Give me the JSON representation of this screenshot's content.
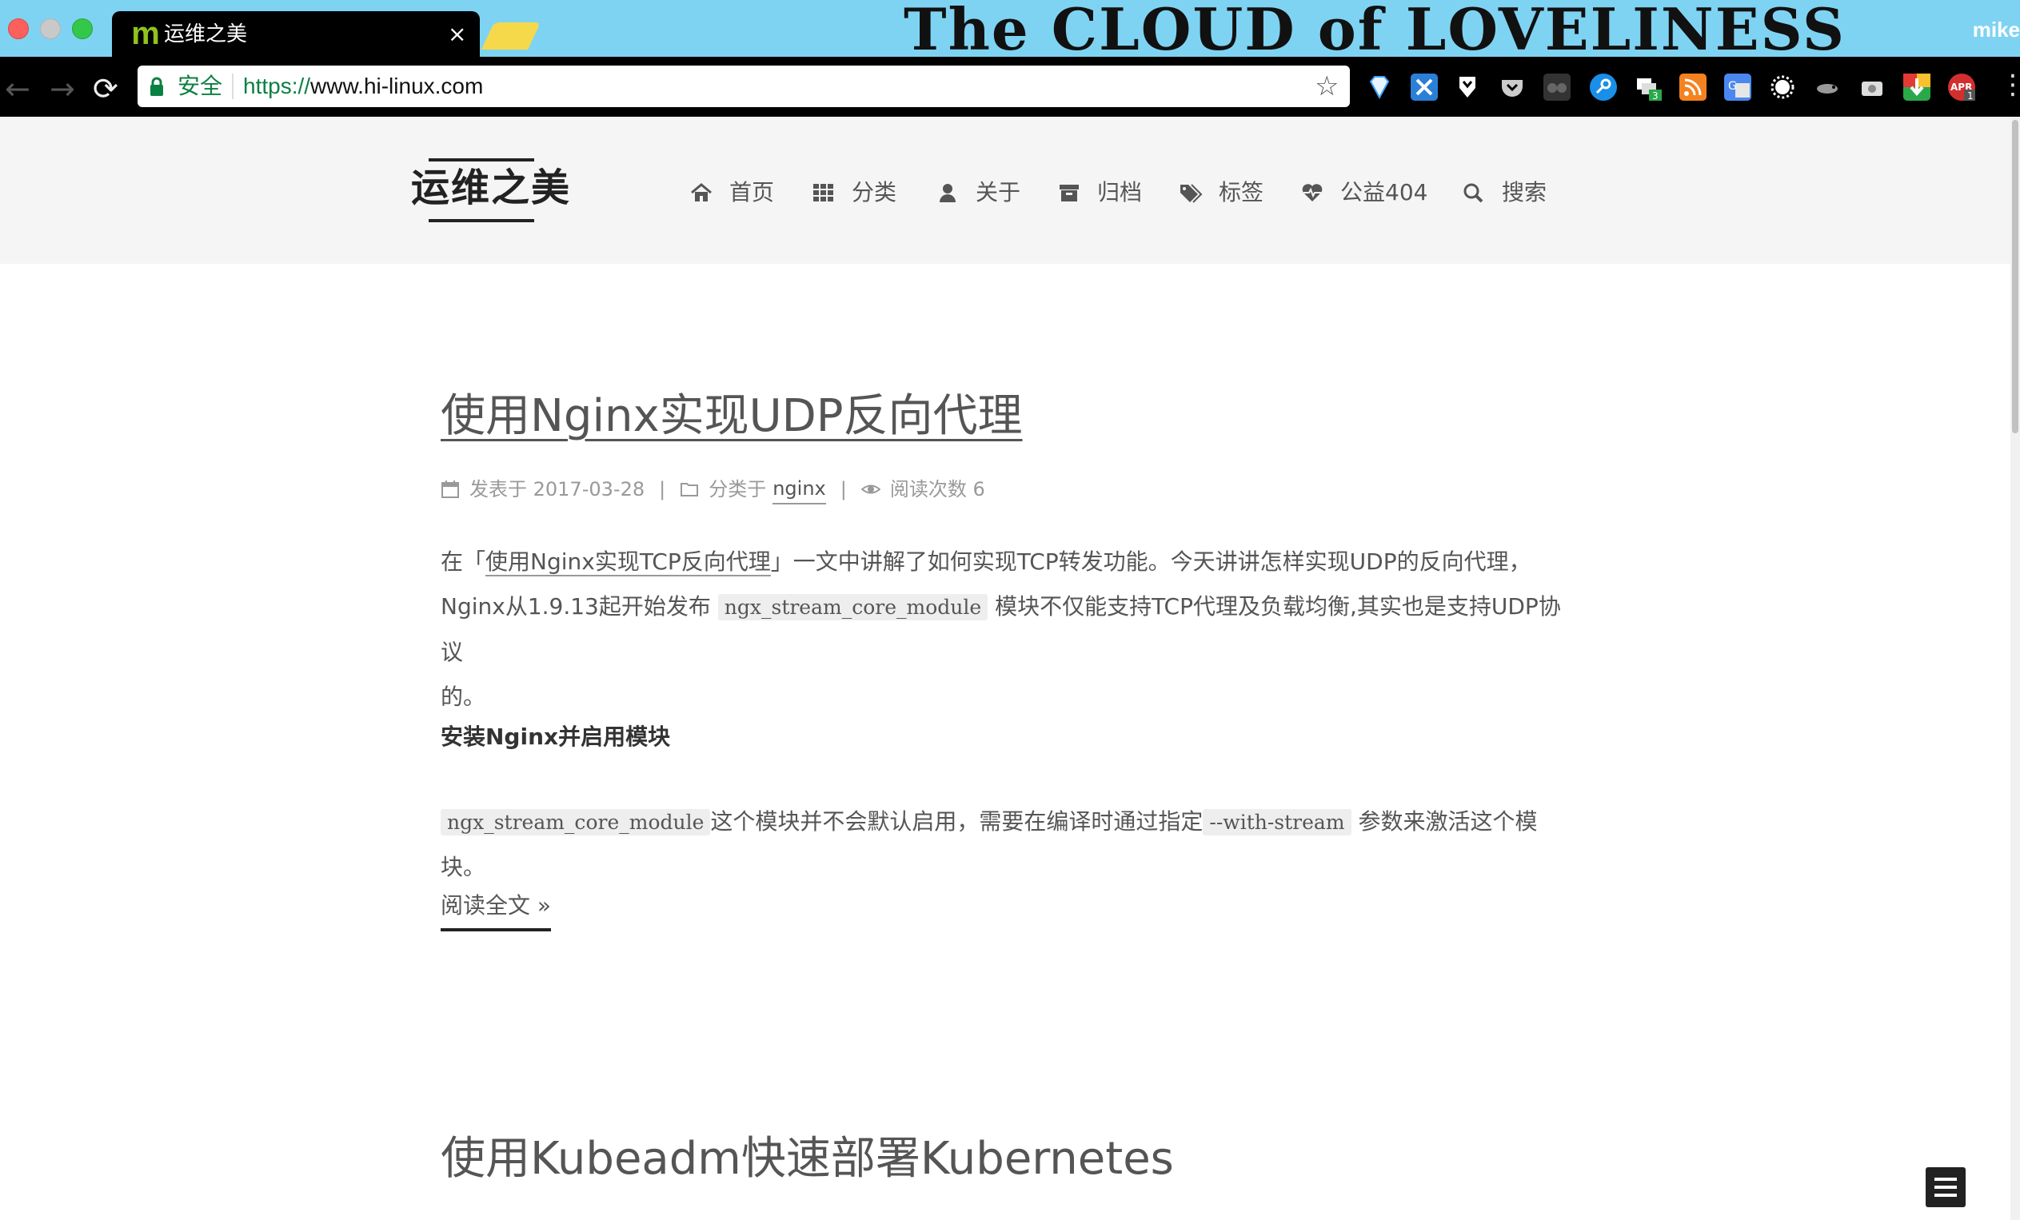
{
  "browser": {
    "tab_title": "运维之美",
    "tab_favicon": "m",
    "tab_close": "×",
    "theme_title": "The CLOUD of LOVELINESS",
    "profile_name": "mike",
    "secure_label": "安全",
    "url_scheme": "https://",
    "url_host": "www.hi-linux.com",
    "nav_back": "←",
    "nav_forward": "→",
    "nav_reload": "⟳",
    "bookmark_star": "☆",
    "menu_dots": "⋮",
    "extensions": [
      "ext-diamond-icon",
      "ext-x-icon",
      "ext-shield-icon",
      "ext-pocket-icon",
      "ext-glasses-icon",
      "ext-key-icon",
      "ext-share-icon",
      "ext-rss-icon",
      "ext-translate-icon",
      "ext-gear-icon",
      "ext-chameleon-icon",
      "ext-camera-icon",
      "ext-download-icon",
      "ext-apr-icon"
    ],
    "extension_badges": {
      "share": "3",
      "apr": "1"
    }
  },
  "site": {
    "brand": "运维之美",
    "menu": [
      {
        "label": "首页",
        "icon": "home-icon"
      },
      {
        "label": "分类",
        "icon": "grid-icon"
      },
      {
        "label": "关于",
        "icon": "user-icon"
      },
      {
        "label": "归档",
        "icon": "archive-icon"
      },
      {
        "label": "标签",
        "icon": "tags-icon"
      },
      {
        "label": "公益404",
        "icon": "heartbeat-icon"
      },
      {
        "label": "搜索",
        "icon": "search-icon"
      }
    ]
  },
  "post1": {
    "title": "使用Nginx实现UDP反向代理",
    "meta": {
      "posted_label": "发表于 2017-03-28",
      "sep1": "|",
      "category_label": "分类于",
      "category": "nginx",
      "sep2": "|",
      "views_label": "阅读次数 6"
    },
    "intro": {
      "p1_a": "在「",
      "p1_link": "使用Nginx实现TCP反向代理",
      "p1_b": "」一文中讲解了如何实现TCP转发功能。今天讲讲怎样实现UDP的反向代理，",
      "p1_c": "Nginx从1.9.13起开始发布",
      "p1_code": "ngx_stream_core_module",
      "p1_d": "模块不仅能支持TCP代理及负载均衡,其实也是支持UDP协议",
      "p1_e": "的。"
    },
    "subheading": "安装Nginx并启用模块",
    "p2_code1": "ngx_stream_core_module",
    "p2_a": "这个模块并不会默认启用，需要在编译时通过指定",
    "p2_code2": "--with-stream",
    "p2_b": "参数来激活这个模块。",
    "read_more": "阅读全文 »"
  },
  "post2": {
    "title": "使用Kubeadm快速部署Kubernetes"
  }
}
